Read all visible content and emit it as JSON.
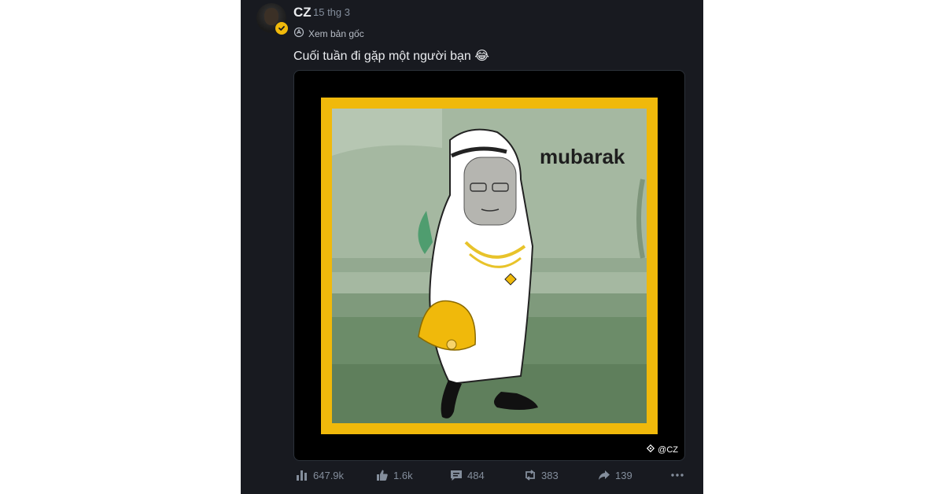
{
  "post": {
    "author": "CZ",
    "date": "15 thg 3",
    "translate_label": "Xem bản gốc",
    "text": "Cuối tuần đi gặp một người bạn 😂",
    "image_text": "mubarak",
    "watermark": "@CZ",
    "icons": {
      "verified": "verified-badge-icon",
      "translate": "translate-icon",
      "views": "bar-chart-icon",
      "likes": "thumbs-up-icon",
      "comments": "comment-icon",
      "reposts": "repost-icon",
      "shares": "share-icon",
      "more": "more-horizontal-icon"
    }
  },
  "stats": {
    "views": "647.9k",
    "likes": "1.6k",
    "comments": "484",
    "reposts": "383",
    "shares": "139"
  },
  "colors": {
    "background": "#181a20",
    "accent": "#f0b90b",
    "muted": "#848e9c",
    "text": "#eaecef"
  }
}
